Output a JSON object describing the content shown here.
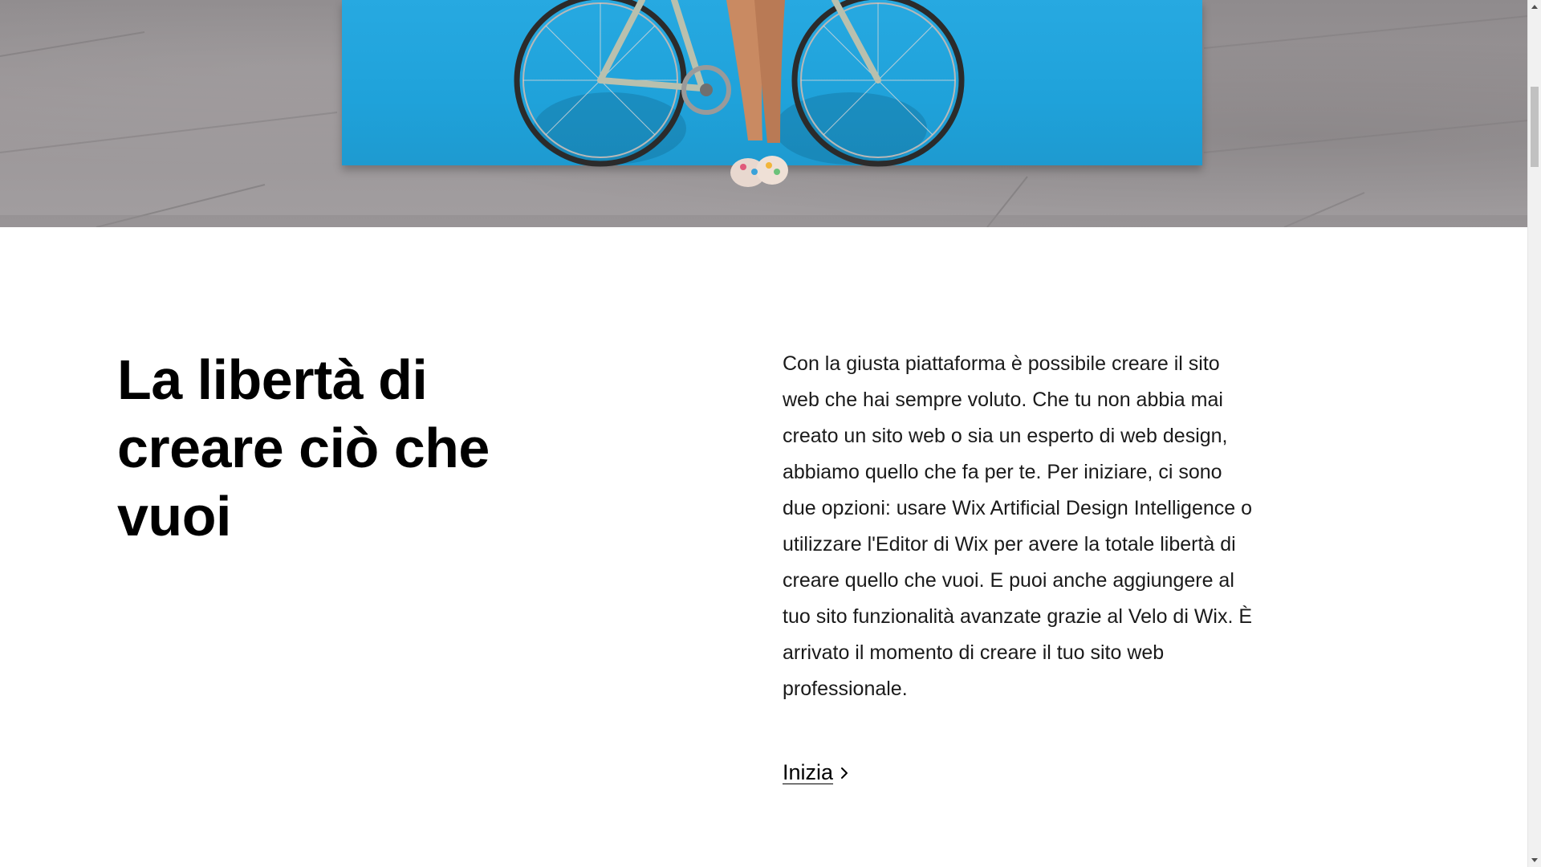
{
  "hero": {
    "image": "woman-with-bicycle-against-blue-wall",
    "colors": {
      "wall": "#1fa2da",
      "pavement": "#9a9597"
    }
  },
  "section": {
    "headline_lines": [
      "La libertà di",
      "creare ciò che",
      "vuoi"
    ],
    "body": "Con la giusta piattaforma è possibile creare il sito web che hai sempre voluto. Che tu non abbia mai creato un sito web o sia un esperto di web design, abbiamo quello che fa per te. Per iniziare, ci sono due opzioni: usare Wix Artificial Design Intelligence o utilizzare l'Editor di Wix per avere la totale libertà di creare quello che vuoi. E puoi anche aggiungere al tuo sito funzionalità avanzate grazie al Velo di Wix. È arrivato il momento di creare il tuo sito web professionale.",
    "cta_label": "Inizia",
    "cta_icon": "chevron-right-icon"
  },
  "scrollbar": {
    "up_icon": "scroll-up-arrow-icon",
    "down_icon": "scroll-down-arrow-icon"
  }
}
